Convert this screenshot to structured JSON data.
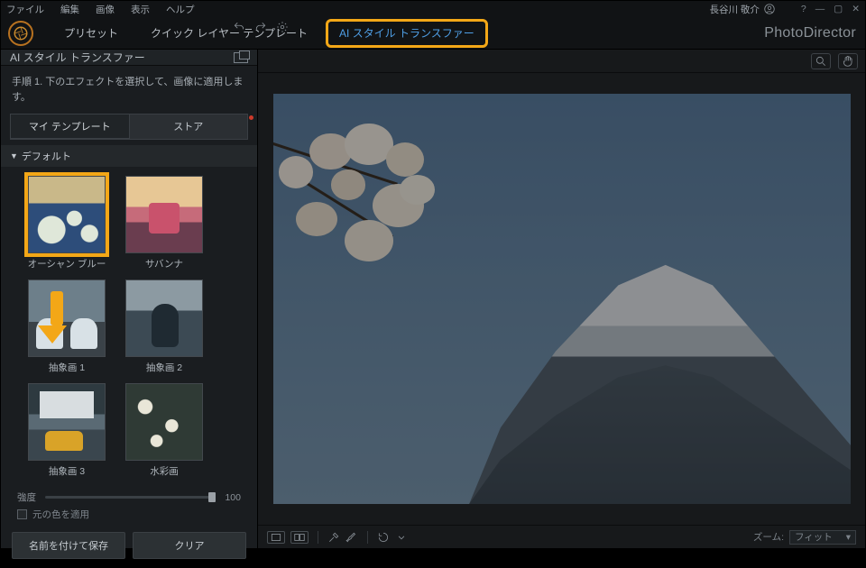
{
  "menu": {
    "file": "ファイル",
    "edit": "編集",
    "image": "画像",
    "view": "表示",
    "help": "ヘルプ"
  },
  "user": {
    "name": "長谷川 敬介"
  },
  "brand": "PhotoDirector",
  "tabs": {
    "preset": "プリセット",
    "quick": "クイック レイヤー テンプレート",
    "ai": "AI スタイル トランスファー"
  },
  "left": {
    "title": "AI スタイル トランスファー",
    "instr": "手順 1. 下のエフェクトを選択して、画像に適用します。",
    "subtabs": {
      "my": "マイ テンプレート",
      "store": "ストア"
    },
    "section": "デフォルト",
    "thumbs": {
      "ocean": "オーシャン ブルー",
      "savanna": "サバンナ",
      "abs1": "抽象画 1",
      "abs2": "抽象画 2",
      "abs3": "抽象画 3",
      "water": "水彩画"
    },
    "slider": {
      "label": "強度",
      "value": "100"
    },
    "keepcolor": "元の色を適用",
    "saveas": "名前を付けて保存",
    "clear": "クリア"
  },
  "bottom": {
    "zoomlbl": "ズーム:",
    "fit": "フィット"
  }
}
